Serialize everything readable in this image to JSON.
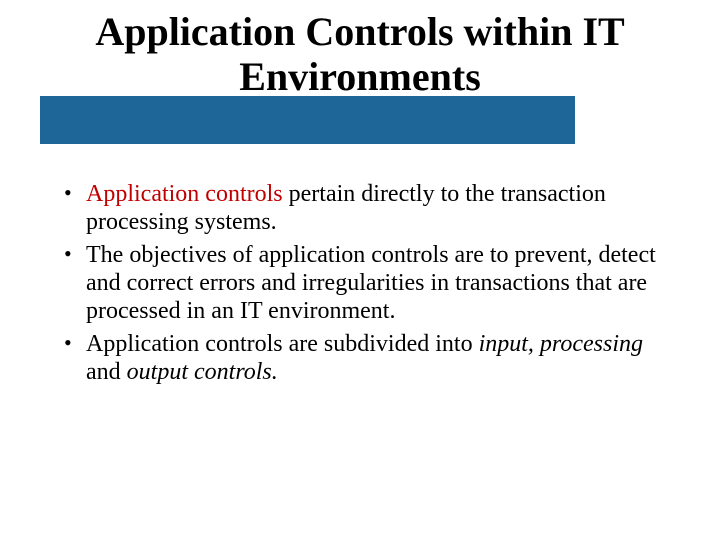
{
  "title": "Application Controls within IT Environments",
  "bullets": [
    {
      "highlight": "Application controls",
      "rest": " pertain directly to the transaction processing systems."
    },
    {
      "text": "The objectives of application controls are to prevent, detect and correct errors and irregularities in transactions that are processed in an IT environment."
    },
    {
      "pre": "Application controls are subdivided into ",
      "it1": "input, processing",
      "mid": " and ",
      "it2": "output controls."
    }
  ]
}
